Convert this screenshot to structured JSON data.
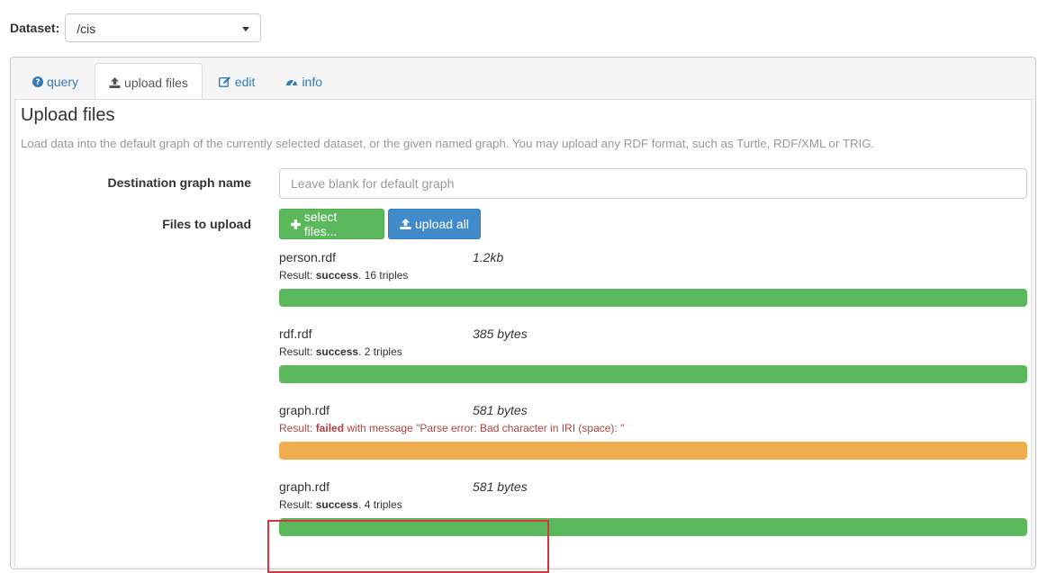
{
  "dataset": {
    "label": "Dataset:",
    "selected": "/cis"
  },
  "tabs": [
    {
      "label": "query",
      "icon": "question-circle-icon"
    },
    {
      "label": "upload files",
      "icon": "upload-icon"
    },
    {
      "label": "edit",
      "icon": "edit-icon"
    },
    {
      "label": "info",
      "icon": "dashboard-icon"
    }
  ],
  "active_tab": "upload files",
  "upload": {
    "title": "Upload files",
    "description": "Load data into the default graph of the currently selected dataset, or the given named graph. You may upload any RDF format, such as Turtle, RDF/XML or TRIG.",
    "destination_label": "Destination graph name",
    "destination_placeholder": "Leave blank for default graph",
    "destination_value": "",
    "files_label": "Files to upload",
    "select_button": "select files...",
    "upload_button": "upload all"
  },
  "files": [
    {
      "name": "person.rdf",
      "size": "1.2kb",
      "result_prefix": "Result: ",
      "status": "success",
      "result_suffix": ". 16 triples",
      "progress": 100,
      "bar_color": "#5cb85c"
    },
    {
      "name": "rdf.rdf",
      "size": "385 bytes",
      "result_prefix": "Result: ",
      "status": "success",
      "result_suffix": ". 2 triples",
      "progress": 100,
      "bar_color": "#5cb85c"
    },
    {
      "name": "graph.rdf",
      "size": "581 bytes",
      "result_prefix": "Result: ",
      "status": "failed",
      "result_suffix": " with message \"Parse error: Bad character in IRI (space): \"",
      "progress": 100,
      "bar_color": "#f0ad4e"
    },
    {
      "name": "graph.rdf",
      "size": "581 bytes",
      "result_prefix": "Result: ",
      "status": "success",
      "result_suffix": ". 4 triples",
      "progress": 100,
      "bar_color": "#5cb85c"
    }
  ],
  "colors": {
    "link": "#337ab7",
    "success": "#5cb85c",
    "primary": "#428bca",
    "warning": "#f0ad4e",
    "danger_text": "#a94442",
    "highlight": "#d9363e"
  }
}
